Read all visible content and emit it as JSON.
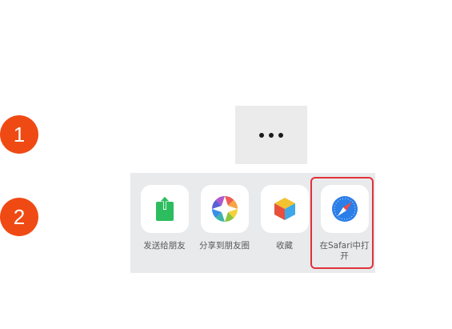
{
  "steps": {
    "first": "1",
    "second": "2"
  },
  "more_button": {
    "icon": "ellipsis-icon"
  },
  "share_sheet": {
    "items": [
      {
        "label": "发送给朋友",
        "icon": "send-to-friend-icon"
      },
      {
        "label": "分享到朋友圈",
        "icon": "moments-icon"
      },
      {
        "label": "收藏",
        "icon": "favorites-icon"
      },
      {
        "label": "在Safari中打开",
        "icon": "safari-compass-icon"
      }
    ]
  },
  "colors": {
    "step_badge": "#f04a14",
    "highlight": "#e0323b",
    "send_green": "#2dbd5f",
    "safari_blue": "#2a7ee8"
  }
}
